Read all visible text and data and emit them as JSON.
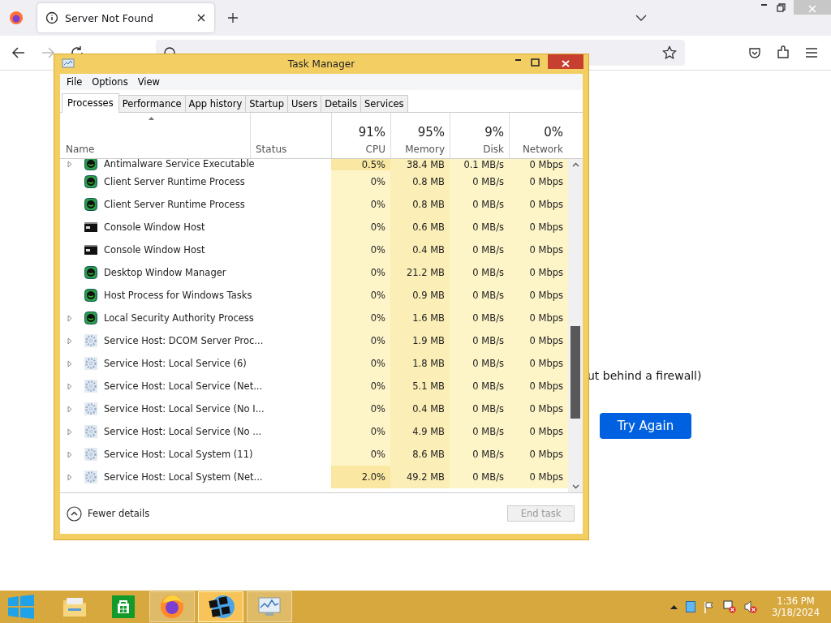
{
  "browser": {
    "tab": {
      "title": "Server Not Found",
      "selected": true
    },
    "page_text": "ut behind a firewall)",
    "retry_button": "Try Again"
  },
  "task_manager": {
    "title": "Task Manager",
    "menu": [
      "File",
      "Options",
      "View"
    ],
    "tabs": [
      {
        "label": "Processes",
        "selected": true
      },
      {
        "label": "Performance",
        "selected": false
      },
      {
        "label": "App history",
        "selected": false
      },
      {
        "label": "Startup",
        "selected": false
      },
      {
        "label": "Users",
        "selected": false
      },
      {
        "label": "Details",
        "selected": false
      },
      {
        "label": "Services",
        "selected": false
      }
    ],
    "columns": [
      {
        "label": "Name"
      },
      {
        "label": "Status"
      },
      {
        "percent": "91%",
        "label": "CPU"
      },
      {
        "percent": "95%",
        "label": "Memory"
      },
      {
        "percent": "9%",
        "label": "Disk"
      },
      {
        "percent": "0%",
        "label": "Network"
      }
    ],
    "rows": [
      {
        "kind": "shield",
        "expandable": true,
        "name": "Antimalware Service Executable",
        "cpu": "0.5%",
        "memory": "38.4 MB",
        "disk": "0.1 MB/s",
        "network": "0 Mbps"
      },
      {
        "kind": "shield",
        "expandable": false,
        "name": "Client Server Runtime Process",
        "cpu": "0%",
        "memory": "0.8 MB",
        "disk": "0 MB/s",
        "network": "0 Mbps"
      },
      {
        "kind": "shield",
        "expandable": false,
        "name": "Client Server Runtime Process",
        "cpu": "0%",
        "memory": "0.8 MB",
        "disk": "0 MB/s",
        "network": "0 Mbps"
      },
      {
        "kind": "console",
        "expandable": false,
        "name": "Console Window Host",
        "cpu": "0%",
        "memory": "0.6 MB",
        "disk": "0 MB/s",
        "network": "0 Mbps"
      },
      {
        "kind": "console",
        "expandable": false,
        "name": "Console Window Host",
        "cpu": "0%",
        "memory": "0.4 MB",
        "disk": "0 MB/s",
        "network": "0 Mbps"
      },
      {
        "kind": "shield",
        "expandable": false,
        "name": "Desktop Window Manager",
        "cpu": "0%",
        "memory": "21.2 MB",
        "disk": "0 MB/s",
        "network": "0 Mbps"
      },
      {
        "kind": "shield",
        "expandable": false,
        "name": "Host Process for Windows Tasks",
        "cpu": "0%",
        "memory": "0.9 MB",
        "disk": "0 MB/s",
        "network": "0 Mbps"
      },
      {
        "kind": "shield",
        "expandable": true,
        "name": "Local Security Authority Process",
        "cpu": "0%",
        "memory": "1.6 MB",
        "disk": "0 MB/s",
        "network": "0 Mbps"
      },
      {
        "kind": "gear",
        "expandable": true,
        "name": "Service Host: DCOM Server Proc...",
        "cpu": "0%",
        "memory": "1.9 MB",
        "disk": "0 MB/s",
        "network": "0 Mbps"
      },
      {
        "kind": "gear",
        "expandable": true,
        "name": "Service Host: Local Service (6)",
        "cpu": "0%",
        "memory": "1.8 MB",
        "disk": "0 MB/s",
        "network": "0 Mbps"
      },
      {
        "kind": "gear",
        "expandable": true,
        "name": "Service Host: Local Service (Net...",
        "cpu": "0%",
        "memory": "5.1 MB",
        "disk": "0 MB/s",
        "network": "0 Mbps"
      },
      {
        "kind": "gear",
        "expandable": true,
        "name": "Service Host: Local Service (No I...",
        "cpu": "0%",
        "memory": "0.4 MB",
        "disk": "0 MB/s",
        "network": "0 Mbps"
      },
      {
        "kind": "gear",
        "expandable": true,
        "name": "Service Host: Local Service (No ...",
        "cpu": "0%",
        "memory": "4.9 MB",
        "disk": "0 MB/s",
        "network": "0 Mbps"
      },
      {
        "kind": "gear",
        "expandable": true,
        "name": "Service Host: Local System (11)",
        "cpu": "0%",
        "memory": "8.6 MB",
        "disk": "0 MB/s",
        "network": "0 Mbps"
      },
      {
        "kind": "gear",
        "expandable": true,
        "name": "Service Host: Local System (Net...",
        "cpu": "2.0%",
        "memory": "49.2 MB",
        "disk": "0 MB/s",
        "network": "0 Mbps"
      }
    ],
    "fewer_details": "Fewer details",
    "end_task": {
      "label": "End task",
      "disabled": true
    }
  },
  "taskbar": {
    "apps": [
      {
        "kind": "explorer",
        "selected": false
      },
      {
        "kind": "store",
        "selected": false
      },
      {
        "kind": "firefox",
        "selected": false
      },
      {
        "kind": "squares",
        "selected": true
      },
      {
        "kind": "taskmgr",
        "selected": false
      }
    ],
    "time": "1:36 PM",
    "date": "3/18/2024"
  }
}
